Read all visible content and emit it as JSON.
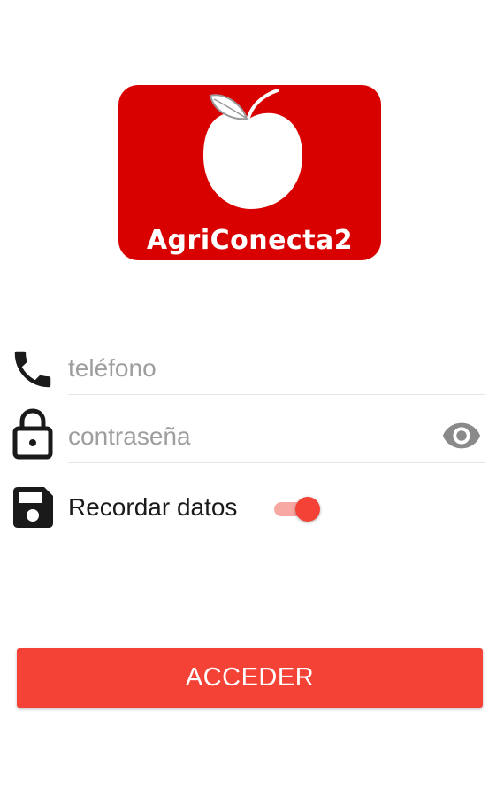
{
  "logo": {
    "text": "AgriConecta2",
    "icon": "apple-icon",
    "background_color": "#d90000"
  },
  "form": {
    "phone": {
      "icon": "phone-icon",
      "placeholder": "teléfono",
      "value": ""
    },
    "password": {
      "icon": "lock-icon",
      "placeholder": "contraseña",
      "value": "",
      "toggle_icon": "eye-icon"
    },
    "remember": {
      "icon": "save-icon",
      "label": "Recordar datos",
      "checked": true
    }
  },
  "submit": {
    "label": "ACCEDER"
  },
  "colors": {
    "accent": "#f44336",
    "toggle_track": "#f7a8a3",
    "placeholder": "#9e9e9e"
  }
}
